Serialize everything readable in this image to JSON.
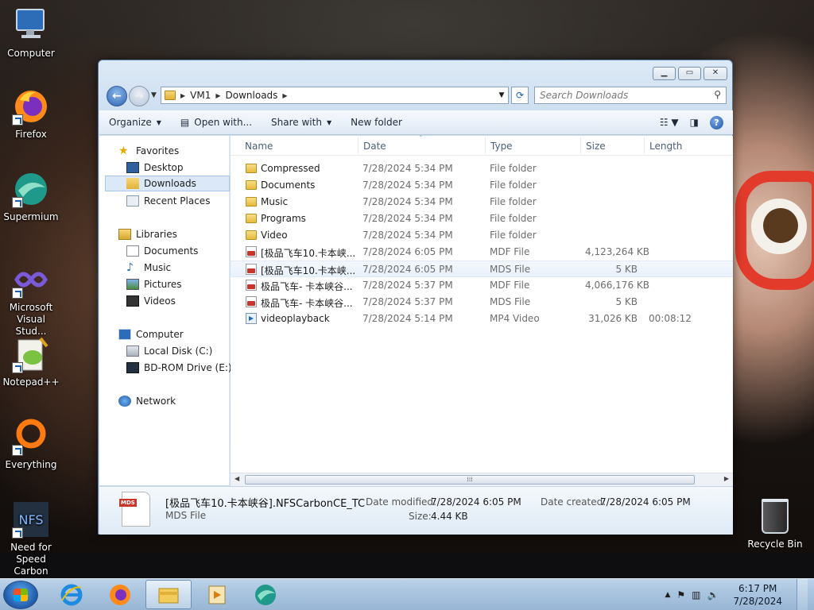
{
  "desktop": {
    "icons": [
      {
        "label": "Computer",
        "icon": "computer-icon"
      },
      {
        "label": "Firefox",
        "icon": "firefox-icon"
      },
      {
        "label": "Supermium",
        "icon": "supermium-icon"
      },
      {
        "label": "Microsoft Visual Stud...",
        "icon": "visual-studio-icon"
      },
      {
        "label": "Notepad++",
        "icon": "notepadpp-icon"
      },
      {
        "label": "Everything",
        "icon": "everything-icon"
      },
      {
        "label": "Need for Speed Carbon",
        "icon": "nfs-carbon-icon"
      }
    ],
    "recycle_bin": "Recycle Bin"
  },
  "window": {
    "address": {
      "crumbs": [
        "VM1",
        "Downloads"
      ]
    },
    "search_placeholder": "Search Downloads",
    "toolbar": {
      "organize": "Organize",
      "open_with": "Open with...",
      "share_with": "Share with",
      "new_folder": "New folder"
    },
    "nav": {
      "favorites": "Favorites",
      "desktop": "Desktop",
      "downloads": "Downloads",
      "recent_places": "Recent Places",
      "libraries": "Libraries",
      "documents": "Documents",
      "music": "Music",
      "pictures": "Pictures",
      "videos": "Videos",
      "computer": "Computer",
      "local_disk": "Local Disk (C:)",
      "bd_rom": "BD-ROM Drive (E:) N",
      "network": "Network"
    },
    "columns": {
      "name": "Name",
      "date": "Date",
      "type": "Type",
      "size": "Size",
      "length": "Length"
    },
    "files": [
      {
        "name": "Compressed",
        "date": "7/28/2024 5:34 PM",
        "type": "File folder",
        "size": "",
        "length": "",
        "icon": "folder"
      },
      {
        "name": "Documents",
        "date": "7/28/2024 5:34 PM",
        "type": "File folder",
        "size": "",
        "length": "",
        "icon": "folder"
      },
      {
        "name": "Music",
        "date": "7/28/2024 5:34 PM",
        "type": "File folder",
        "size": "",
        "length": "",
        "icon": "folder"
      },
      {
        "name": "Programs",
        "date": "7/28/2024 5:34 PM",
        "type": "File folder",
        "size": "",
        "length": "",
        "icon": "folder"
      },
      {
        "name": "Video",
        "date": "7/28/2024 5:34 PM",
        "type": "File folder",
        "size": "",
        "length": "",
        "icon": "folder"
      },
      {
        "name": "[极品飞车10.卡本峡...",
        "date": "7/28/2024 6:05 PM",
        "type": "MDF File",
        "size": "4,123,264 KB",
        "length": "",
        "icon": "disc"
      },
      {
        "name": "[极品飞车10.卡本峡...",
        "date": "7/28/2024 6:05 PM",
        "type": "MDS File",
        "size": "5 KB",
        "length": "",
        "icon": "disc"
      },
      {
        "name": "极品飞车- 卡本峡谷...",
        "date": "7/28/2024 5:37 PM",
        "type": "MDF File",
        "size": "4,066,176 KB",
        "length": "",
        "icon": "disc"
      },
      {
        "name": "极品飞车- 卡本峡谷...",
        "date": "7/28/2024 5:37 PM",
        "type": "MDS File",
        "size": "5 KB",
        "length": "",
        "icon": "disc"
      },
      {
        "name": "videoplayback",
        "date": "7/28/2024 5:14 PM",
        "type": "MP4 Video",
        "size": "31,026 KB",
        "length": "00:08:12",
        "icon": "video"
      }
    ],
    "details": {
      "filename": "[极品飞车10.卡本峡谷].NFSCarbonCE_TC",
      "filetype": "MDS File",
      "modified_label": "Date modified:",
      "modified_value": "7/28/2024 6:05 PM",
      "created_label": "Date created:",
      "created_value": "7/28/2024 6:05 PM",
      "size_label": "Size:",
      "size_value": "4.44 KB",
      "badge": "MDS"
    }
  },
  "taskbar": {
    "clock_time": "6:17 PM",
    "clock_date": "7/28/2024"
  }
}
